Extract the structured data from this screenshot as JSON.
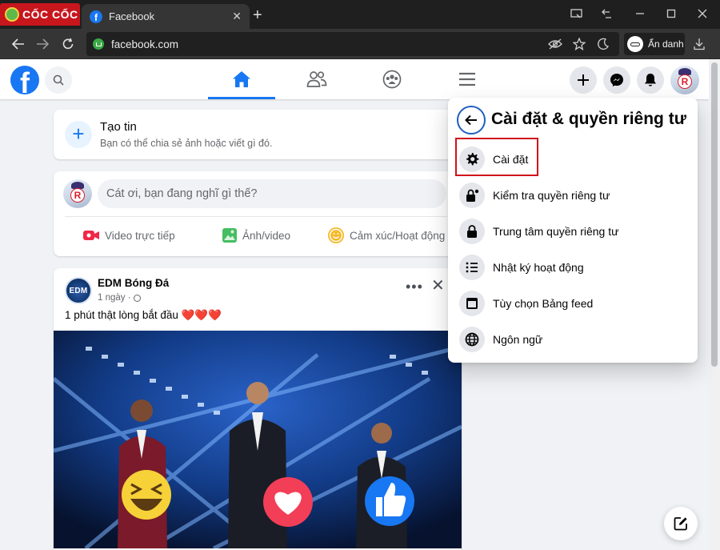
{
  "browser": {
    "brand": "CỐC CỐC",
    "tab_title": "Facebook",
    "url": "facebook.com",
    "incognito_label": "Ẩn danh"
  },
  "header": {
    "nav_tabs": [
      "home-icon",
      "friends-icon",
      "groups-icon",
      "menu-icon"
    ],
    "active_tab": "home-icon",
    "actions": [
      "plus-icon",
      "messenger-icon",
      "notification-bell-icon"
    ]
  },
  "story_box": {
    "title": "Tạo tin",
    "subtitle": "Bạn có thể chia sẻ ảnh hoặc viết gì đó."
  },
  "composer": {
    "placeholder": "Cát ơi, bạn đang nghĩ gì thế?",
    "actions": [
      {
        "label": "Video trực tiếp",
        "icon": "live-video-icon",
        "color": "#f02849"
      },
      {
        "label": "Ảnh/video",
        "icon": "photo-icon",
        "color": "#45bd62"
      },
      {
        "label": "Cảm xúc/Hoạt động",
        "icon": "feeling-icon",
        "color": "#f7b928"
      }
    ]
  },
  "post": {
    "avatar_text": "EDM",
    "author": "EDM Bóng Đá",
    "time": "1 ngày ·",
    "text": "1 phút thật lòng bắt đầu ❤️❤️❤️"
  },
  "menu": {
    "title": "Cài đặt & quyền riêng tư",
    "items": [
      {
        "label": "Cài đặt",
        "icon": "gear-icon"
      },
      {
        "label": "Kiểm tra quyền riêng tư",
        "icon": "lock-check-icon"
      },
      {
        "label": "Trung tâm quyền riêng tư",
        "icon": "lock-icon"
      },
      {
        "label": "Nhật ký hoạt động",
        "icon": "list-icon"
      },
      {
        "label": "Tùy chọn Bảng feed",
        "icon": "feed-icon"
      },
      {
        "label": "Ngôn ngữ",
        "icon": "globe-icon"
      }
    ],
    "highlighted_item": "Cài đặt"
  },
  "colors": {
    "fb_blue": "#1877f2",
    "highlight_red": "#d0121b",
    "browser_red": "#c8161d"
  }
}
